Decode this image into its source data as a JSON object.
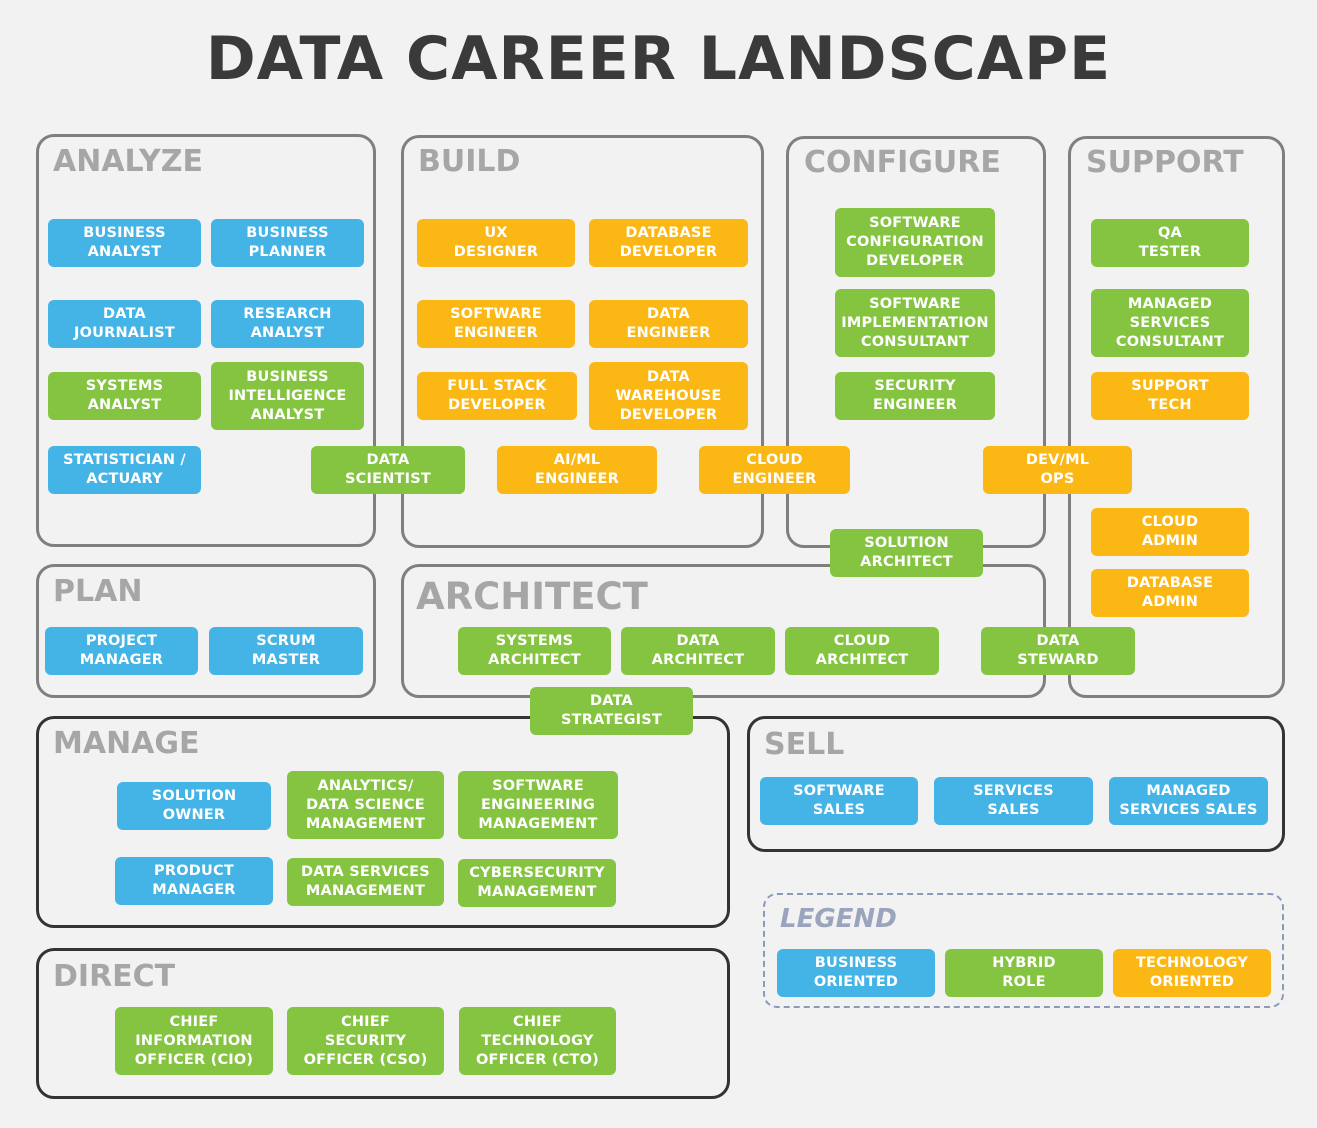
{
  "title": "DATA CAREER LANDSCAPE",
  "groups": {
    "analyze": "ANALYZE",
    "build": "BUILD",
    "configure": "CONFIGURE",
    "support": "SUPPORT",
    "plan": "PLAN",
    "architect": "ARCHITECT",
    "manage": "MANAGE",
    "sell": "SELL",
    "direct": "DIRECT",
    "legend": "LEGEND"
  },
  "roles": {
    "business_analyst": "BUSINESS\nANALYST",
    "business_planner": "BUSINESS\nPLANNER",
    "data_journalist": "DATA\nJOURNALIST",
    "research_analyst": "RESEARCH\nANALYST",
    "systems_analyst": "SYSTEMS\nANALYST",
    "bi_analyst": "BUSINESS\nINTELLIGENCE\nANALYST",
    "statistician": "STATISTICIAN /\nACTUARY",
    "ux_designer": "UX\nDESIGNER",
    "database_developer": "DATABASE\nDEVELOPER",
    "software_engineer": "SOFTWARE\nENGINEER",
    "data_engineer": "DATA\nENGINEER",
    "full_stack_developer": "FULL STACK\nDEVELOPER",
    "data_warehouse_developer": "DATA\nWAREHOUSE\nDEVELOPER",
    "data_scientist": "DATA\nSCIENTIST",
    "aiml_engineer": "AI/ML\nENGINEER",
    "cloud_engineer": "CLOUD\nENGINEER",
    "devml_ops": "DEV/ML\nOPS",
    "software_config_developer": "SOFTWARE\nCONFIGURATION\nDEVELOPER",
    "software_impl_consultant": "SOFTWARE\nIMPLEMENTATION\nCONSULTANT",
    "security_engineer": "SECURITY\nENGINEER",
    "solution_architect": "SOLUTION\nARCHITECT",
    "qa_tester": "QA\nTESTER",
    "managed_services_consultant": "MANAGED\nSERVICES\nCONSULTANT",
    "support_tech": "SUPPORT\nTECH",
    "cloud_admin": "CLOUD\nADMIN",
    "database_admin": "DATABASE\nADMIN",
    "project_manager": "PROJECT\nMANAGER",
    "scrum_master": "SCRUM\nMASTER",
    "systems_architect": "SYSTEMS\nARCHITECT",
    "data_architect": "DATA\nARCHITECT",
    "cloud_architect": "CLOUD\nARCHITECT",
    "data_steward": "DATA\nSTEWARD",
    "data_strategist": "DATA\nSTRATEGIST",
    "solution_owner": "SOLUTION\nOWNER",
    "analytics_ds_management": "ANALYTICS/\nDATA SCIENCE\nMANAGEMENT",
    "software_eng_management": "SOFTWARE\nENGINEERING\nMANAGEMENT",
    "product_manager": "PRODUCT\nMANAGER",
    "data_services_management": "DATA SERVICES\nMANAGEMENT",
    "cybersecurity_management": "CYBERSECURITY\nMANAGEMENT",
    "software_sales": "SOFTWARE\nSALES",
    "services_sales": "SERVICES\nSALES",
    "managed_services_sales": "MANAGED\nSERVICES SALES",
    "cio": "CHIEF\nINFORMATION\nOFFICER (CIO)",
    "cso": "CHIEF\nSECURITY\nOFFICER (CSO)",
    "cto": "CHIEF\nTECHNOLOGY\nOFFICER (CTO)"
  },
  "legend": {
    "business": "BUSINESS\nORIENTED",
    "hybrid": "HYBRID\nROLE",
    "technology": "TECHNOLOGY\nORIENTED"
  },
  "colors": {
    "business": "#44b3e6",
    "hybrid": "#85c441",
    "technology": "#fbb714"
  }
}
